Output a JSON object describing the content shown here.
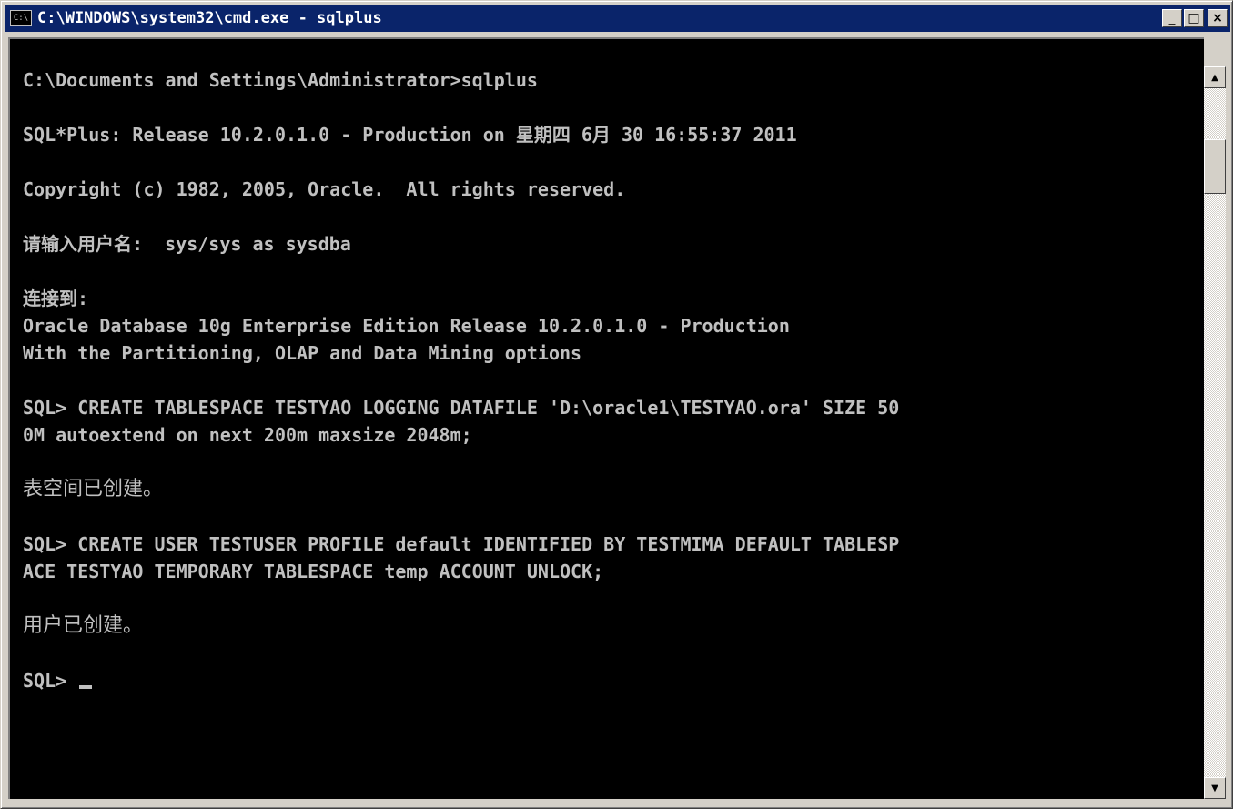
{
  "window": {
    "title": "C:\\WINDOWS\\system32\\cmd.exe - sqlplus",
    "system_icon": "C:\\",
    "controls": {
      "minimize": "_",
      "maximize": "□",
      "close": "×"
    }
  },
  "console": {
    "lines": [
      "C:\\Documents and Settings\\Administrator>sqlplus",
      "",
      "SQL*Plus: Release 10.2.0.1.0 - Production on 星期四 6月 30 16:55:37 2011",
      "",
      "Copyright (c) 1982, 2005, Oracle.  All rights reserved.",
      "",
      "请输入用户名:  sys/sys as sysdba",
      "",
      "连接到:",
      "Oracle Database 10g Enterprise Edition Release 10.2.0.1.0 - Production",
      "With the Partitioning, OLAP and Data Mining options",
      "",
      "SQL> CREATE TABLESPACE TESTYAO LOGGING DATAFILE 'D:\\oracle1\\TESTYAO.ora' SIZE 50",
      "0M autoextend on next 200m maxsize 2048m;",
      "",
      "表空间已创建。",
      "",
      "SQL> CREATE USER TESTUSER PROFILE default IDENTIFIED BY TESTMIMA DEFAULT TABLESP",
      "ACE TESTYAO TEMPORARY TABLESPACE temp ACCOUNT UNLOCK;",
      "",
      "用户已创建。",
      "",
      "SQL> "
    ]
  },
  "colors": {
    "titlebar": "#0a246a",
    "console_bg": "#000000",
    "console_text": "#c0c0c0"
  },
  "icons": {
    "scroll_up": "triangle-up",
    "scroll_down": "triangle-down"
  }
}
